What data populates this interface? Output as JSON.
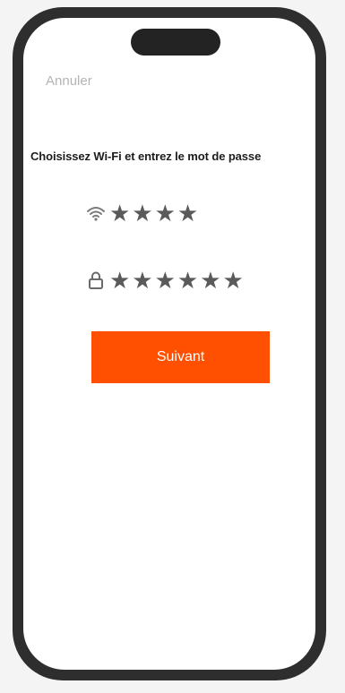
{
  "header": {
    "cancel_label": "Annuler"
  },
  "main": {
    "title": "Choisissez Wi-Fi et entrez le mot de passe",
    "wifi_field": {
      "icon": "wifi-icon",
      "value": "★★★★"
    },
    "password_field": {
      "icon": "lock-icon",
      "value": "★★★★★★"
    },
    "next_button_label": "Suivant"
  },
  "colors": {
    "accent": "#ff4f00",
    "frame": "#2e2e2e",
    "muted_text": "#b4b4b4"
  }
}
